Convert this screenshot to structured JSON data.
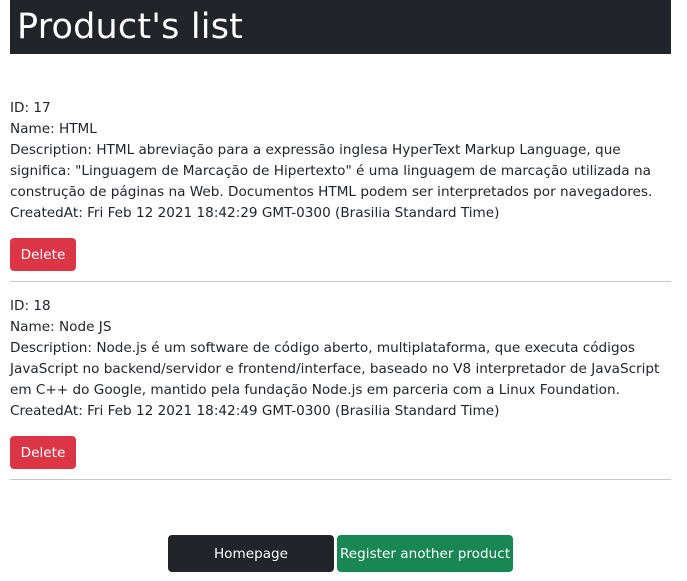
{
  "header": {
    "title": "Product's list"
  },
  "products": [
    {
      "id_line": "ID: 17",
      "name_line": "Name: HTML",
      "description_line": "Description: HTML abreviação para a expressão inglesa HyperText Markup Language, que significa: \"Linguagem de Marcação de Hipertexto\" é uma linguagem de marcação utilizada na construção de páginas na Web. Documentos HTML podem ser interpretados por navegadores.",
      "created_line": "CreatedAt: Fri Feb 12 2021 18:42:29 GMT-0300 (Brasilia Standard Time)",
      "delete_label": "Delete"
    },
    {
      "id_line": "ID: 18",
      "name_line": "Name: Node JS",
      "description_line": "Description: Node.js é um software de código aberto, multiplataforma, que executa códigos JavaScript no backend/servidor e frontend/interface, baseado no V8 interpretador de JavaScript em C++ do Google, mantido pela fundação Node.js em parceria com a Linux Foundation.",
      "created_line": "CreatedAt: Fri Feb 12 2021 18:42:49 GMT-0300 (Brasilia Standard Time)",
      "delete_label": "Delete"
    }
  ],
  "footer": {
    "homepage_label": "Homepage",
    "register_label": "Register another product"
  },
  "colors": {
    "header_bg": "#212529",
    "delete_bg": "#dc3545",
    "register_bg": "#198754",
    "homepage_bg": "#212529"
  }
}
